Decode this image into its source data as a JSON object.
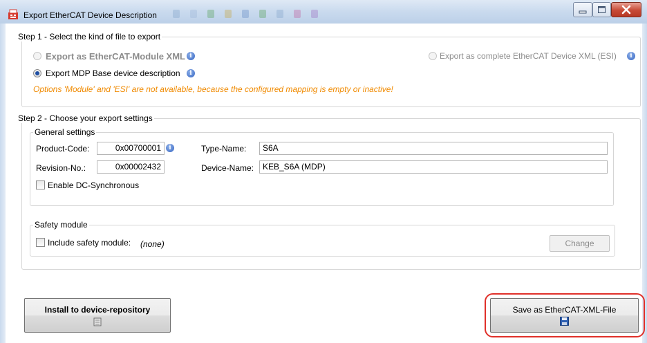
{
  "window": {
    "title": "Export EtherCAT Device Description"
  },
  "step1": {
    "legend": "Step 1 - Select the kind of file to export",
    "option_module": "Export as EtherCAT-Module XML",
    "option_esi": "Export as complete EtherCAT Device XML (ESI)",
    "option_mdp": "Export MDP Base device description",
    "selected": "option_mdp",
    "warning": "Options 'Module' and 'ESI' are not available, because the configured mapping is empty or inactive!"
  },
  "step2": {
    "legend": "Step 2 - Choose your export settings",
    "general": {
      "legend": "General settings",
      "product_code_label": "Product-Code:",
      "product_code_value": "0x00700001",
      "revision_label": "Revision-No.:",
      "revision_value": "0x00002432",
      "type_name_label": "Type-Name:",
      "type_name_value": "S6A",
      "device_name_label": "Device-Name:",
      "device_name_value": "KEB_S6A (MDP)",
      "dc_sync_label": "Enable DC-Synchronous",
      "dc_sync_checked": false
    },
    "safety": {
      "legend": "Safety module",
      "include_label": "Include safety module:",
      "include_checked": false,
      "value": "(none)",
      "change_button": "Change"
    }
  },
  "buttons": {
    "install": "Install to device-repository",
    "save": "Save as EtherCAT-XML-File"
  },
  "colors": {
    "warning": "#f08a00",
    "highlight": "#e0302a",
    "titlebar": "#c9daee"
  },
  "icons": {
    "app": "ethercat-app-icon",
    "info": "info-icon",
    "repository": "repository-icon",
    "save": "floppy-disk-icon"
  }
}
